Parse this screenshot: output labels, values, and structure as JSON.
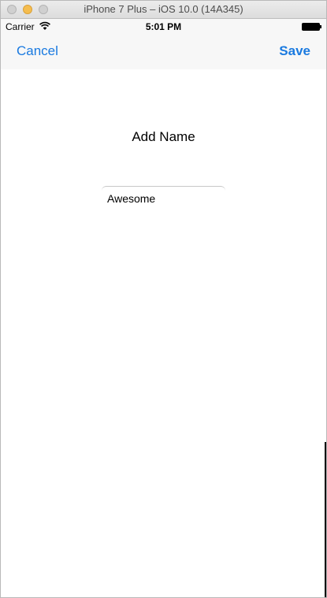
{
  "window": {
    "title": "iPhone 7 Plus – iOS 10.0 (14A345)"
  },
  "status_bar": {
    "carrier": "Carrier",
    "time": "5:01 PM",
    "icons": [
      "wifi-icon",
      "battery-icon"
    ]
  },
  "nav_bar": {
    "cancel_label": "Cancel",
    "save_label": "Save",
    "tint_color": "#1a7ae0"
  },
  "main": {
    "heading": "Add Name",
    "name_field": {
      "value": "Awesome",
      "placeholder": ""
    }
  }
}
